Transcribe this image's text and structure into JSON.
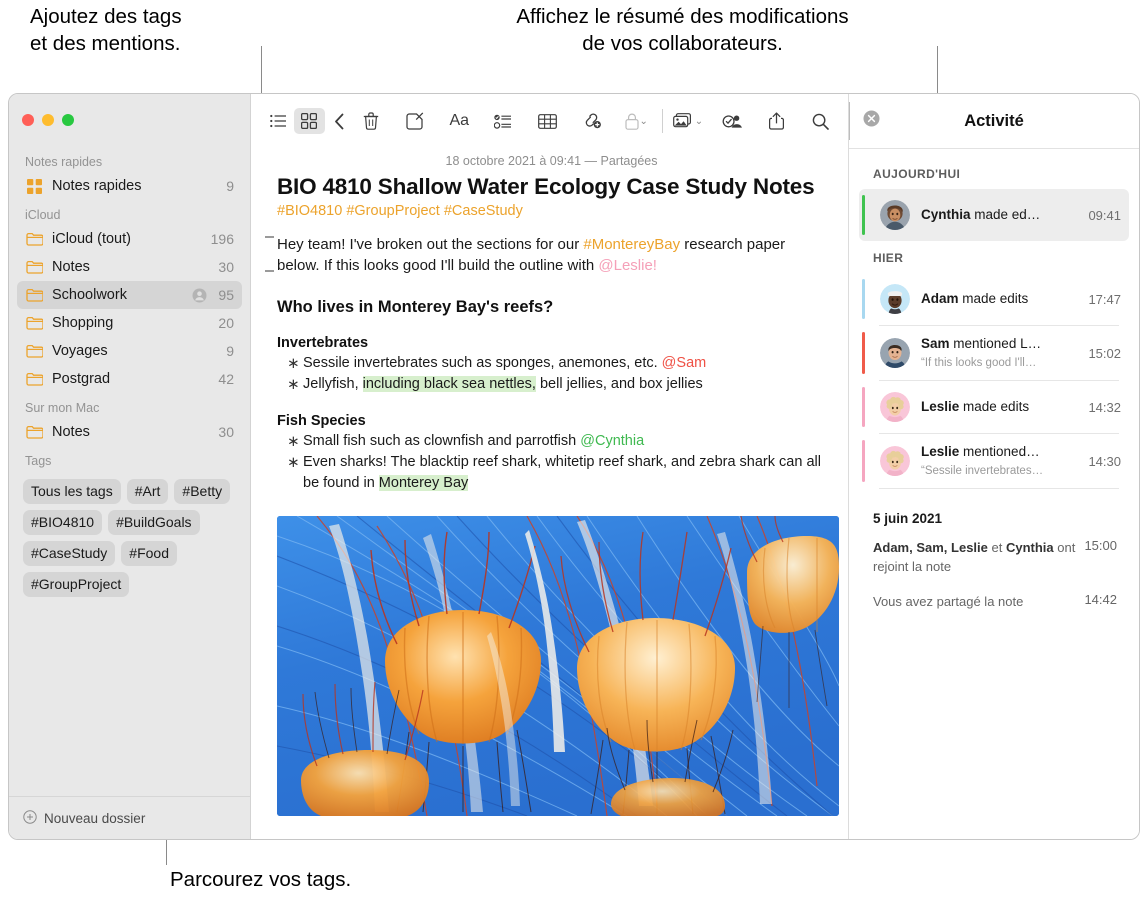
{
  "callouts": {
    "tags": "Ajoutez des tags\net des mentions.",
    "activity": "Affichez le résumé des modifications\nde vos collaborateurs.",
    "browse": "Parcourez vos tags."
  },
  "sidebar": {
    "sections": [
      {
        "title": "Notes rapides",
        "rows": [
          {
            "icon": "quicknote-grid-icon",
            "label": "Notes rapides",
            "count": "9",
            "selected": false,
            "shared": false
          }
        ]
      },
      {
        "title": "iCloud",
        "rows": [
          {
            "icon": "folder-icon",
            "label": "iCloud (tout)",
            "count": "196",
            "selected": false,
            "shared": false
          },
          {
            "icon": "folder-icon",
            "label": "Notes",
            "count": "30",
            "selected": false,
            "shared": false
          },
          {
            "icon": "folder-icon",
            "label": "Schoolwork",
            "count": "95",
            "selected": true,
            "shared": true
          },
          {
            "icon": "folder-icon",
            "label": "Shopping",
            "count": "20",
            "selected": false,
            "shared": false
          },
          {
            "icon": "folder-icon",
            "label": "Voyages",
            "count": "9",
            "selected": false,
            "shared": false
          },
          {
            "icon": "folder-icon",
            "label": "Postgrad",
            "count": "42",
            "selected": false,
            "shared": false
          }
        ]
      },
      {
        "title": "Sur mon Mac",
        "rows": [
          {
            "icon": "folder-icon",
            "label": "Notes",
            "count": "30",
            "selected": false,
            "shared": false
          }
        ]
      }
    ],
    "tags_title": "Tags",
    "tags": [
      "Tous les tags",
      "#Art",
      "#Betty",
      "#BIO4810",
      "#BuildGoals",
      "#CaseStudy",
      "#Food",
      "#GroupProject"
    ],
    "footer": "Nouveau dossier"
  },
  "toolbar": {
    "list_view": "list-view",
    "gallery_view": "gallery-view",
    "back": "back",
    "delete": "delete-note",
    "compose": "compose-note",
    "format": "Aa",
    "checklist": "checklist",
    "table": "table",
    "link": "add-link",
    "lock": "lock-note",
    "media": "add-media",
    "collaborate": "collaborate",
    "share": "share",
    "search": "search"
  },
  "note": {
    "date": "18 octobre 2021 à 09:41 — Partagées",
    "title": "BIO 4810 Shallow Water Ecology Case Study Notes",
    "tags": "#BIO4810 #GroupProject #CaseStudy",
    "intro": {
      "part1": "Hey team! I've broken out the sections for our ",
      "hashtag": "#MontereyBay",
      "part2": " research paper below. If this looks good I'll build the outline with ",
      "mention": "@Leslie!"
    },
    "heading": "Who lives in Monterey Bay's reefs?",
    "sections": [
      {
        "subheading": "Invertebrates",
        "items": [
          {
            "text": "Sessile invertebrates such as sponges, anemones, etc. ",
            "mention": "@Sam",
            "mention_color": "red"
          },
          {
            "pre": "Jellyfish, ",
            "highlight": "including black sea nettles,",
            "post": " bell jellies, and box jellies"
          }
        ]
      },
      {
        "subheading": "Fish Species",
        "items": [
          {
            "text": "Small fish such as clownfish and parrotfish ",
            "mention": "@Cynthia",
            "mention_color": "green"
          },
          {
            "pre": "Even sharks! The blacktip reef shark, whitetip reef shark, and zebra shark can all be found in ",
            "highlight": "Monterey Bay",
            "post": ""
          }
        ]
      }
    ],
    "image_alt": "jellyfish-photo"
  },
  "activity": {
    "title": "Activité",
    "close": "close-activity",
    "groups": [
      {
        "label": "AUJOURD'HUI",
        "items": [
          {
            "name": "Cynthia",
            "action": " made ed…",
            "quote": "",
            "time": "09:41",
            "color": "#3fc34f",
            "highlight": true,
            "avatar": "photo-cynthia"
          }
        ]
      },
      {
        "label": "HIER",
        "items": [
          {
            "name": "Adam",
            "action": " made edits",
            "quote": "",
            "time": "17:47",
            "color": "#a8d8f0",
            "highlight": false,
            "avatar": "memoji-adam"
          },
          {
            "name": "Sam",
            "action": " mentioned L…",
            "quote": "“If this looks good I'll…",
            "time": "15:02",
            "color": "#f05b4a",
            "highlight": false,
            "avatar": "photo-sam"
          },
          {
            "name": "Leslie",
            "action": " made edits",
            "quote": "",
            "time": "14:32",
            "color": "#f5a6c0",
            "highlight": false,
            "avatar": "memoji-leslie"
          },
          {
            "name": "Leslie",
            "action": " mentioned…",
            "quote": "“Sessile invertebrates…",
            "time": "14:30",
            "color": "#f5a6c0",
            "highlight": false,
            "avatar": "memoji-leslie"
          }
        ]
      }
    ],
    "older": {
      "date": "5 juin 2021",
      "rows": [
        {
          "bold": "Adam, Sam, Leslie",
          "rest": " et ",
          "bold2": "Cynthia",
          "rest2": " ont rejoint la note",
          "time": "15:00"
        },
        {
          "bold": "",
          "rest": "Vous avez partagé la note",
          "bold2": "",
          "rest2": "",
          "time": "14:42"
        }
      ]
    }
  },
  "colors": {
    "accent_orange": "#eca32c",
    "mention_pink": "#f5a0b8",
    "mention_red": "#ef5145",
    "mention_green": "#3fb950",
    "highlight_green": "#d7efcd"
  }
}
